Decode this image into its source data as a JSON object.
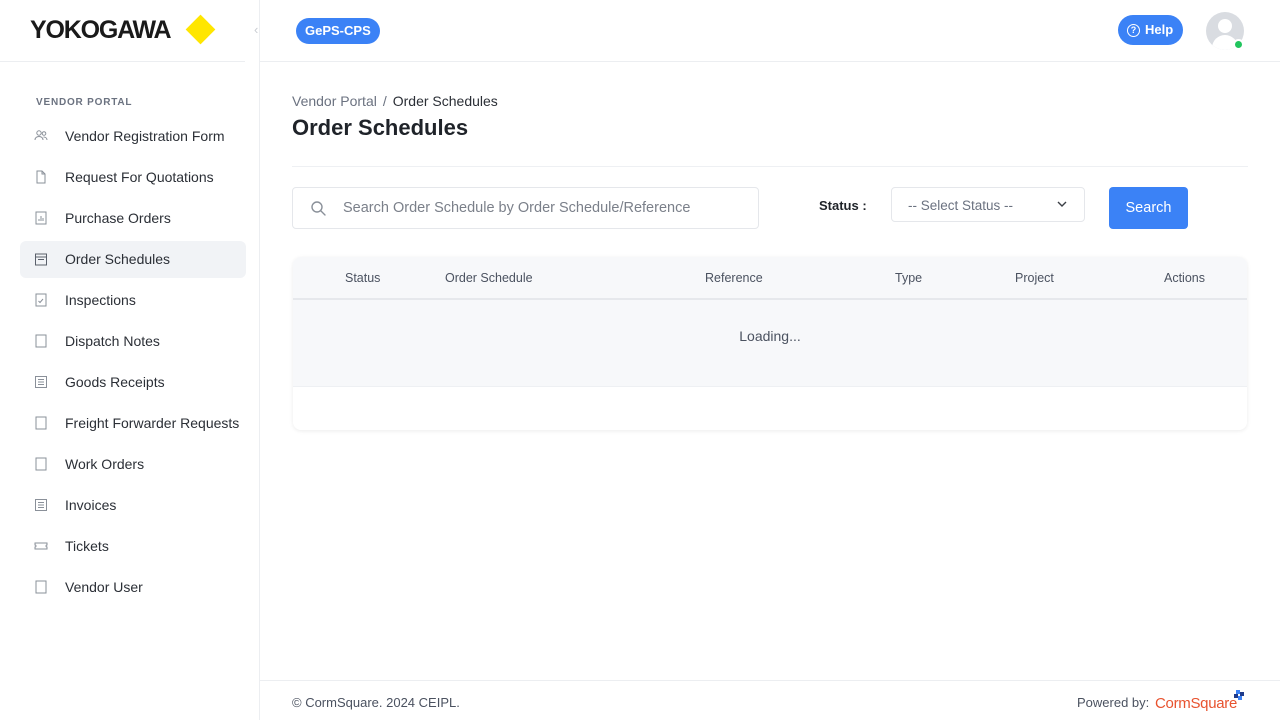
{
  "brand": {
    "logo_text": "YOKOGAWA",
    "accent": "#3b82f6",
    "logo_color": "#ffe600"
  },
  "header": {
    "app_badge": "GePS-CPS",
    "help_label": "Help"
  },
  "sidebar": {
    "section_label": "VENDOR PORTAL",
    "items": [
      {
        "label": "Vendor Registration Form",
        "icon": "users-icon"
      },
      {
        "label": "Request For Quotations",
        "icon": "document-icon"
      },
      {
        "label": "Purchase Orders",
        "icon": "chart-doc-icon"
      },
      {
        "label": "Order Schedules",
        "icon": "calendar-icon",
        "active": true
      },
      {
        "label": "Inspections",
        "icon": "check-doc-icon"
      },
      {
        "label": "Dispatch Notes",
        "icon": "note-icon"
      },
      {
        "label": "Goods Receipts",
        "icon": "list-doc-icon"
      },
      {
        "label": "Freight Forwarder Requests",
        "icon": "note-icon"
      },
      {
        "label": "Work Orders",
        "icon": "note-icon"
      },
      {
        "label": "Invoices",
        "icon": "list-doc-icon"
      },
      {
        "label": "Tickets",
        "icon": "ticket-icon"
      },
      {
        "label": "Vendor User",
        "icon": "note-icon"
      }
    ]
  },
  "breadcrumb": {
    "root": "Vendor Portal",
    "separator": "/",
    "current": "Order Schedules"
  },
  "page": {
    "title": "Order Schedules"
  },
  "filters": {
    "search_placeholder": "Search Order Schedule by Order Schedule/Reference",
    "search_value": "",
    "status_label": "Status :",
    "status_selected": "-- Select Status --",
    "search_button": "Search"
  },
  "table": {
    "columns": [
      "Status",
      "Order Schedule",
      "Reference",
      "Type",
      "Project",
      "Actions"
    ],
    "loading_text": "Loading..."
  },
  "footer": {
    "copyright": "© CormSquare. 2024 CEIPL.",
    "powered_by": "Powered by:",
    "powered_brand": "CormSquare"
  }
}
